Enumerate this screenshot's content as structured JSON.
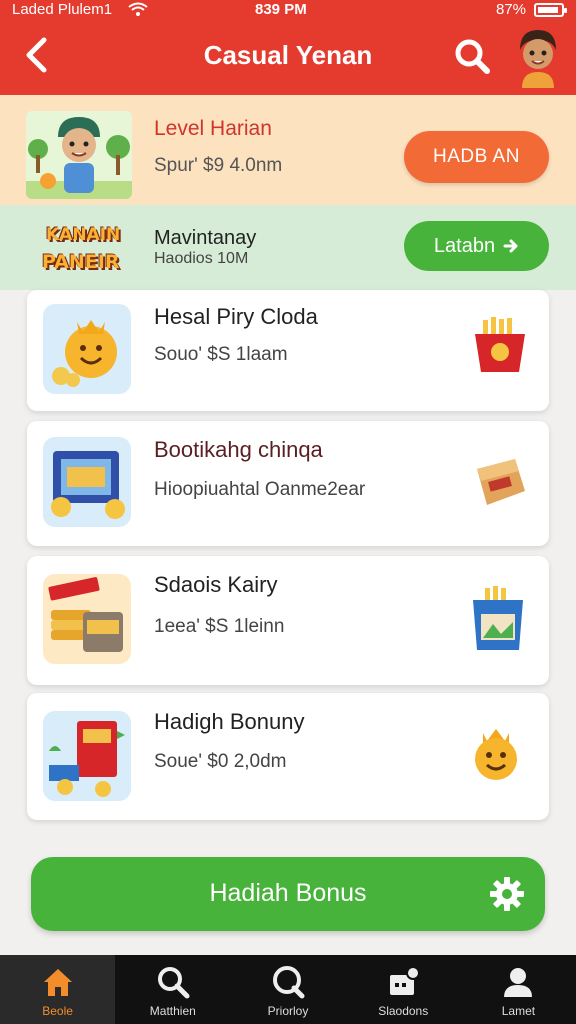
{
  "status_bar": {
    "carrier": "Laded Plulem1",
    "time": "839 PM",
    "battery": "87%"
  },
  "header": {
    "title": "Casual Yenan",
    "back_icon": "chevron-left-icon",
    "search_icon": "search-icon"
  },
  "level_banner": {
    "title": "Level Harian",
    "subtitle": "Spur' $9 4.0nm",
    "button": "HADB AN"
  },
  "promo_banner": {
    "logo_line1": "KANAIN",
    "logo_line2": "PANEIR",
    "title": "Mavintanay",
    "subtitle": "Haodios 10M",
    "button": "Latabn"
  },
  "cards": [
    {
      "title": "Hesal Piry Cloda",
      "subtitle": "Souo' $S 1laam"
    },
    {
      "title": "Bootikahg chinqa",
      "subtitle": "Hioopiuahtal Oanme2ear"
    },
    {
      "title": "Sdaois Kairy",
      "subtitle": "1eea' $S 1leinn"
    },
    {
      "title": "Hadigh Bonuny",
      "subtitle": "Soue' $0 2,0dm"
    }
  ],
  "bonus_button": {
    "label": "Hadiah Bonus"
  },
  "bottom_nav": [
    {
      "label": "Beole",
      "icon": "home-icon",
      "active": true
    },
    {
      "label": "Matthien",
      "icon": "search-icon",
      "active": false
    },
    {
      "label": "Priorloy",
      "icon": "search-icon",
      "active": false
    },
    {
      "label": "Slaodons",
      "icon": "store-icon",
      "active": false
    },
    {
      "label": "Lamet",
      "icon": "profile-icon",
      "active": false
    }
  ],
  "colors": {
    "header_red": "#e53b2f",
    "orange_button": "#f26a35",
    "green_button": "#47b33b",
    "level_banner_bg": "#fde2c0",
    "promo_banner_bg": "#d6ecd6",
    "nav_active": "#f38d2c"
  }
}
